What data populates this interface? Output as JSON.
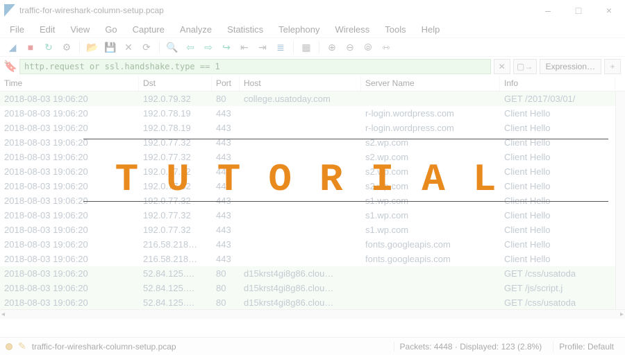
{
  "overlay_text": "TUTORIAL",
  "window": {
    "title": "traffic-for-wireshark-column-setup.pcap",
    "minimize": "–",
    "maximize": "□",
    "close": "×"
  },
  "menu": [
    "File",
    "Edit",
    "View",
    "Go",
    "Capture",
    "Analyze",
    "Statistics",
    "Telephony",
    "Wireless",
    "Tools",
    "Help"
  ],
  "filter": {
    "value": "http.request or ssl.handshake.type == 1",
    "clear": "✕",
    "apply": "▢→",
    "expression": "Expression…",
    "plus": "+"
  },
  "columns": {
    "time": "Time",
    "dst": "Dst",
    "port": "Port",
    "host": "Host",
    "server": "Server Name",
    "info": "Info"
  },
  "rows": [
    {
      "http": true,
      "time": "2018-08-03 19:06:20",
      "dst": "192.0.79.32",
      "port": "80",
      "host": "college.usatoday.com",
      "srv": "",
      "info": "GET /2017/03/01/"
    },
    {
      "http": false,
      "time": "2018-08-03 19:06:20",
      "dst": "192.0.78.19",
      "port": "443",
      "host": "",
      "srv": "r-login.wordpress.com",
      "info": "Client Hello"
    },
    {
      "http": false,
      "time": "2018-08-03 19:06:20",
      "dst": "192.0.78.19",
      "port": "443",
      "host": "",
      "srv": "r-login.wordpress.com",
      "info": "Client Hello"
    },
    {
      "http": false,
      "time": "2018-08-03 19:06:20",
      "dst": "192.0.77.32",
      "port": "443",
      "host": "",
      "srv": "s2.wp.com",
      "info": "Client Hello"
    },
    {
      "http": false,
      "time": "2018-08-03 19:06:20",
      "dst": "192.0.77.32",
      "port": "443",
      "host": "",
      "srv": "s2.wp.com",
      "info": "Client Hello"
    },
    {
      "http": false,
      "time": "2018-08-03 19:06:20",
      "dst": "192.0.77.32",
      "port": "443",
      "host": "",
      "srv": "s2.wp.com",
      "info": "Client Hello"
    },
    {
      "http": false,
      "time": "2018-08-03 19:06:20",
      "dst": "192.0.77.32",
      "port": "443",
      "host": "",
      "srv": "s2.wp.com",
      "info": "Client Hello"
    },
    {
      "http": false,
      "time": "2018-08-03 19:06:20",
      "dst": "192.0.77.32",
      "port": "443",
      "host": "",
      "srv": "s1.wp.com",
      "info": "Client Hello"
    },
    {
      "http": false,
      "time": "2018-08-03 19:06:20",
      "dst": "192.0.77.32",
      "port": "443",
      "host": "",
      "srv": "s1.wp.com",
      "info": "Client Hello"
    },
    {
      "http": false,
      "time": "2018-08-03 19:06:20",
      "dst": "192.0.77.32",
      "port": "443",
      "host": "",
      "srv": "s1.wp.com",
      "info": "Client Hello"
    },
    {
      "http": false,
      "time": "2018-08-03 19:06:20",
      "dst": "216.58.218…",
      "port": "443",
      "host": "",
      "srv": "fonts.googleapis.com",
      "info": "Client Hello"
    },
    {
      "http": false,
      "time": "2018-08-03 19:06:20",
      "dst": "216.58.218…",
      "port": "443",
      "host": "",
      "srv": "fonts.googleapis.com",
      "info": "Client Hello"
    },
    {
      "http": true,
      "time": "2018-08-03 19:06:20",
      "dst": "52.84.125.…",
      "port": "80",
      "host": "d15krst4gi8g86.clou…",
      "srv": "",
      "info": "GET /css/usatoda"
    },
    {
      "http": true,
      "time": "2018-08-03 19:06:20",
      "dst": "52.84.125.…",
      "port": "80",
      "host": "d15krst4gi8g86.clou…",
      "srv": "",
      "info": "GET /js/script.j"
    },
    {
      "http": true,
      "time": "2018-08-03 19:06:20",
      "dst": "52.84.125.…",
      "port": "80",
      "host": "d15krst4gi8g86.clou…",
      "srv": "",
      "info": "GET /css/usatoda"
    }
  ],
  "status": {
    "file": "traffic-for-wireshark-column-setup.pcap",
    "packets": "Packets: 4448 · Displayed: 123 (2.8%)",
    "profile": "Profile: Default"
  }
}
